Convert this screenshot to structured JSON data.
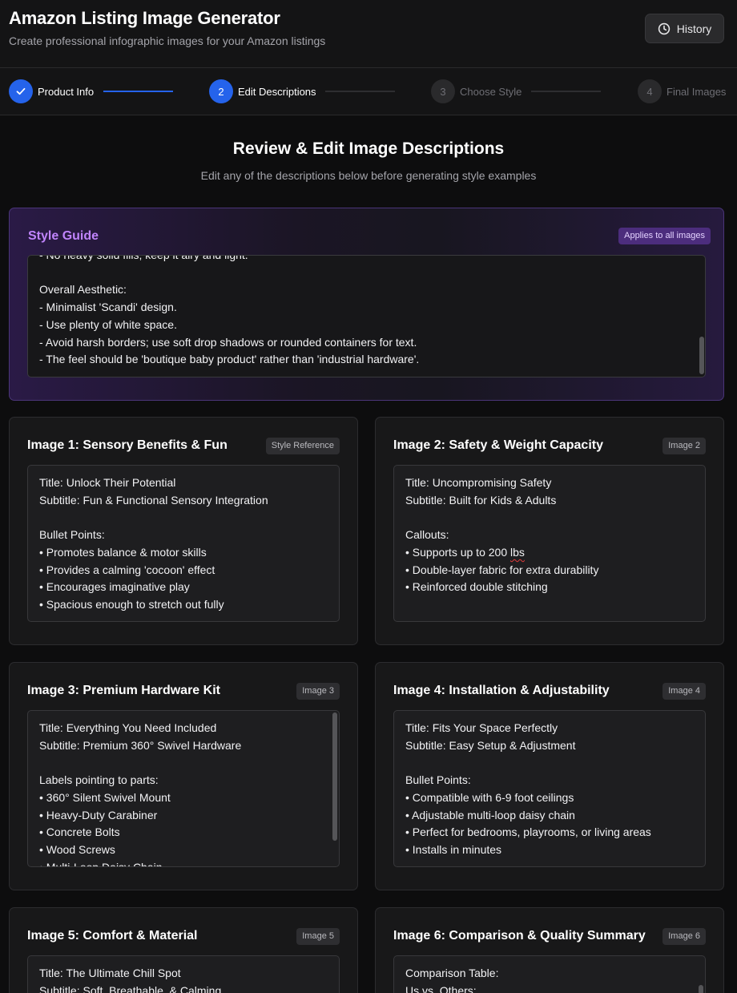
{
  "header": {
    "title": "Amazon Listing Image Generator",
    "subtitle": "Create professional infographic images for your Amazon listings",
    "history_label": "History"
  },
  "stepper": {
    "steps": [
      {
        "number": "1",
        "label": "Product Info",
        "state": "done"
      },
      {
        "number": "2",
        "label": "Edit Descriptions",
        "state": "active"
      },
      {
        "number": "3",
        "label": "Choose Style",
        "state": "todo"
      },
      {
        "number": "4",
        "label": "Final Images",
        "state": "todo"
      }
    ]
  },
  "section": {
    "title": "Review & Edit Image Descriptions",
    "subtitle": "Edit any of the descriptions below before generating style examples"
  },
  "style_guide": {
    "title": "Style Guide",
    "badge": "Applies to all images",
    "text": "- No heavy solid fills; keep it airy and light.\n\nOverall Aesthetic:\n- Minimalist 'Scandi' design.\n- Use plenty of white space.\n- Avoid harsh borders; use soft drop shadows or rounded containers for text.\n- The feel should be 'boutique baby product' rather than 'industrial hardware'."
  },
  "images": [
    {
      "title": "Image 1: Sensory Benefits & Fun",
      "badge": "Style Reference",
      "text": "Title: Unlock Their Potential\nSubtitle: Fun & Functional Sensory Integration\n\nBullet Points:\n• Promotes balance & motor skills\n• Provides a calming 'cocoon' effect\n• Encourages imaginative play\n• Spacious enough to stretch out fully"
    },
    {
      "title": "Image 2: Safety & Weight Capacity",
      "badge": "Image 2",
      "text_before": "Title: Uncompromising Safety\nSubtitle: Built for Kids & Adults\n\nCallouts:\n• Supports up to 200 ",
      "text_flagged": "lbs",
      "text_after": "\n• Double-layer fabric for extra durability\n• Reinforced double stitching"
    },
    {
      "title": "Image 3: Premium Hardware Kit",
      "badge": "Image 3",
      "text": "Title: Everything You Need Included\nSubtitle: Premium 360° Swivel Hardware\n\nLabels pointing to parts:\n• 360° Silent Swivel Mount\n• Heavy-Duty Carabiner\n• Concrete Bolts\n• Wood Screws\n• Multi-Loop Daisy Chain"
    },
    {
      "title": "Image 4: Installation & Adjustability",
      "badge": "Image 4",
      "text": "Title: Fits Your Space Perfectly\nSubtitle: Easy Setup & Adjustment\n\nBullet Points:\n• Compatible with 6-9 foot ceilings\n• Adjustable multi-loop daisy chain\n• Perfect for bedrooms, playrooms, or living areas\n• Installs in minutes"
    },
    {
      "title": "Image 5: Comfort & Material",
      "badge": "Image 5",
      "text": "Title: The Ultimate Chill Spot\nSubtitle: Soft, Breathable, & Calming"
    },
    {
      "title": "Image 6: Comparison & Quality Summary",
      "badge": "Image 6",
      "text": "Comparison Table:\nUs vs. Others:"
    }
  ]
}
